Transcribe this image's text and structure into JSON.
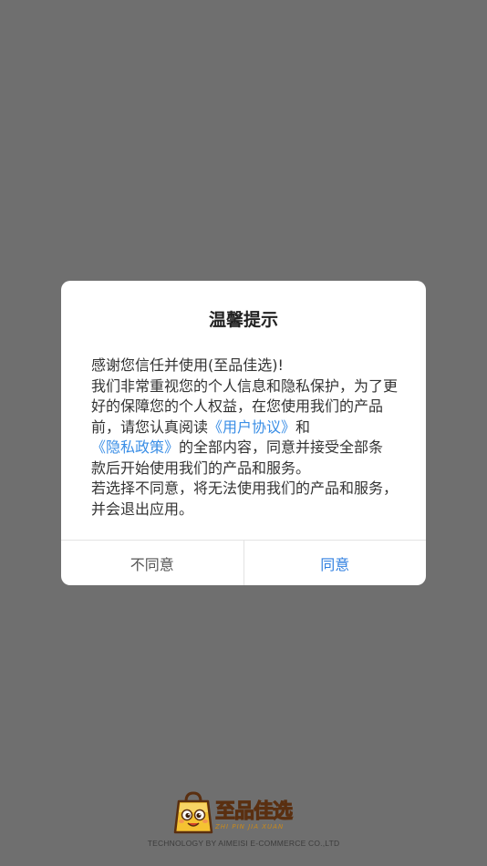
{
  "dialog": {
    "title": "温馨提示",
    "paragraph_1": "感谢您信任并使用(至品佳选)!",
    "paragraph_2_before_link1": "我们非常重视您的个人信息和隐私保护，为了更好的保障您的个人权益，在您使用我们的产品前，请您认真阅读",
    "link_user_agreement": "《用户协议》",
    "paragraph_2_between": "和",
    "link_privacy_policy": "《隐私政策》",
    "paragraph_2_after_link2": "的全部内容，同意并接受全部条款后开始使用我们的产品和服务。",
    "paragraph_3": "若选择不同意，将无法使用我们的产品和服务，并会退出应用。",
    "disagree_label": "不同意",
    "agree_label": "同意"
  },
  "brand": {
    "logo_text": "至品佳选",
    "logo_subtext": "ZHI PIN JIA XUAN",
    "company": "TECHNOLOGY BY AIMEISI E-COMMERCE CO.,LTD"
  },
  "colors": {
    "overlay": "#6f6f6f",
    "link": "#3a8ee6",
    "agree": "#2f7fe0",
    "logo": "#e0a11d"
  }
}
